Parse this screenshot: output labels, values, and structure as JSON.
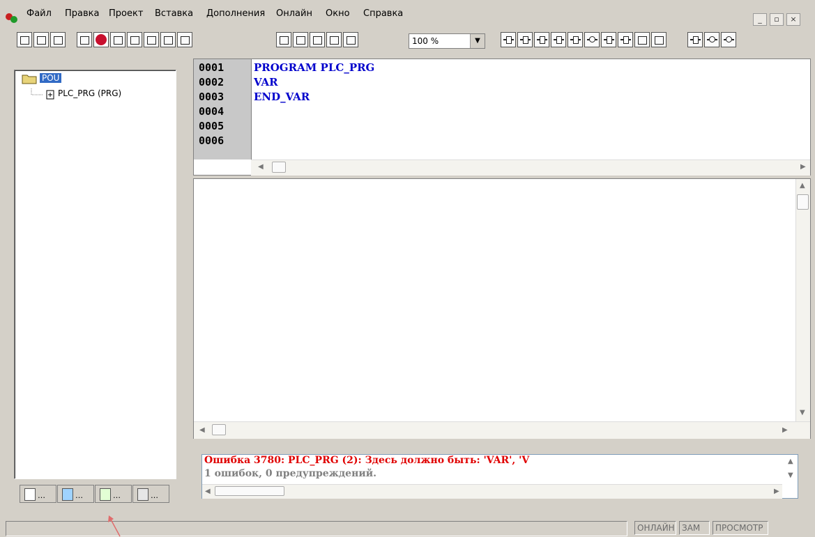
{
  "menu": [
    "Файл",
    "Правка",
    "Проект",
    "Вставка",
    "Дополнения",
    "Онлайн",
    "Окно",
    "Справка"
  ],
  "window_controls": {
    "minimize": "_",
    "restore": "▫",
    "close": "×"
  },
  "toolbar": {
    "zoom": "100 %",
    "icons": [
      "new-icon",
      "open-icon",
      "save-icon",
      "login-icon",
      "stop-icon",
      "run-icon",
      "step-icon",
      "print-icon",
      "print-preview-icon",
      "find-icon",
      "cut-icon",
      "copy-icon",
      "paste-icon",
      "find-next-icon",
      "replace-icon",
      "contact-icon",
      "coil-icon",
      "box-icon",
      "en-box-icon",
      "set-reset-icon",
      "enable-icon"
    ]
  },
  "tree": {
    "root": "POU",
    "child": "PLC_PRG (PRG)",
    "tabs": [
      "…",
      "…",
      "…",
      "…"
    ]
  },
  "editor": {
    "line_numbers": [
      "0001",
      "0002",
      "0003",
      "0004",
      "0005",
      "0006"
    ],
    "code": [
      "PROGRAM PLC_PRG",
      "VAR",
      "END_VAR",
      "",
      "",
      ""
    ]
  },
  "messages": {
    "error": "Ошибка 3780: PLC_PRG (2): Здесь должно быть: 'VAR', 'V",
    "summary": "1 ошибок, 0 предупреждений.",
    "error_color": "#e00000",
    "summary_color": "#808080"
  },
  "status": [
    "ОНЛАЙН",
    "ЗАМ",
    "ПРОСМОТР"
  ]
}
